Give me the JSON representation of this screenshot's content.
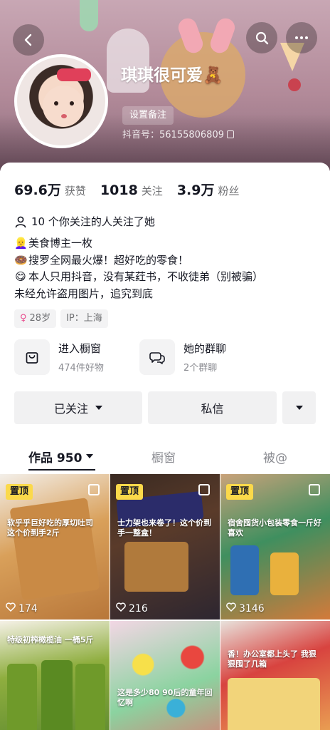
{
  "profile": {
    "nickname": "琪琪很可爱🧸",
    "remark_button": "设置备注",
    "douyin_id": "抖音号：56155806809"
  },
  "stats": [
    {
      "value": "69.6万",
      "label": "获赞"
    },
    {
      "value": "1018",
      "label": "关注"
    },
    {
      "value": "3.9万",
      "label": "粉丝"
    }
  ],
  "mutual_follow_text": "10 个你关注的人关注了她",
  "bio": [
    {
      "emoji": "👱‍♀️",
      "text": "美食博主一枚"
    },
    {
      "emoji": "🍩",
      "text": "搜罗全网最火爆！超好吃的零食！"
    },
    {
      "emoji": "😋",
      "text": "本人只用抖音，没有某荭书，不收徒弟（别被骗）"
    },
    {
      "emoji": "",
      "text": "未经允许盗用图片，追究到底"
    }
  ],
  "tags": {
    "age": "28岁",
    "ip": "IP：上海"
  },
  "entries": {
    "shop": {
      "title": "进入橱窗",
      "subtitle": "474件好物"
    },
    "group": {
      "title": "她的群聊",
      "subtitle": "2个群聊"
    }
  },
  "actions": {
    "follow": "已关注",
    "message": "私信"
  },
  "tabs": {
    "works": "作品 950",
    "shop": "橱窗",
    "mentions": "被@"
  },
  "grid": [
    {
      "pinned": "置顶",
      "caption": "软乎乎巨好吃的厚切吐司 这个价到手2斤",
      "likes": "174"
    },
    {
      "pinned": "置顶",
      "caption": "士力架也来卷了！这个价到手一整盒！",
      "likes": "216"
    },
    {
      "pinned": "置顶",
      "caption": "宿舍囤货小包装零食一斤好喜欢",
      "likes": "3146"
    },
    {
      "pinned": "",
      "caption": "特级初榨橄榄油 一桶5斤",
      "likes": ""
    },
    {
      "pinned": "",
      "caption": "这是多少80 90后的童年回忆啊",
      "likes": ""
    },
    {
      "pinned": "",
      "caption": "香！办公室都上头了 我狠狠囤了几箱",
      "likes": ""
    }
  ],
  "colors": {
    "accent_pinned": "#fbd94a",
    "text_primary": "#161823",
    "text_secondary": "#6f7073"
  }
}
